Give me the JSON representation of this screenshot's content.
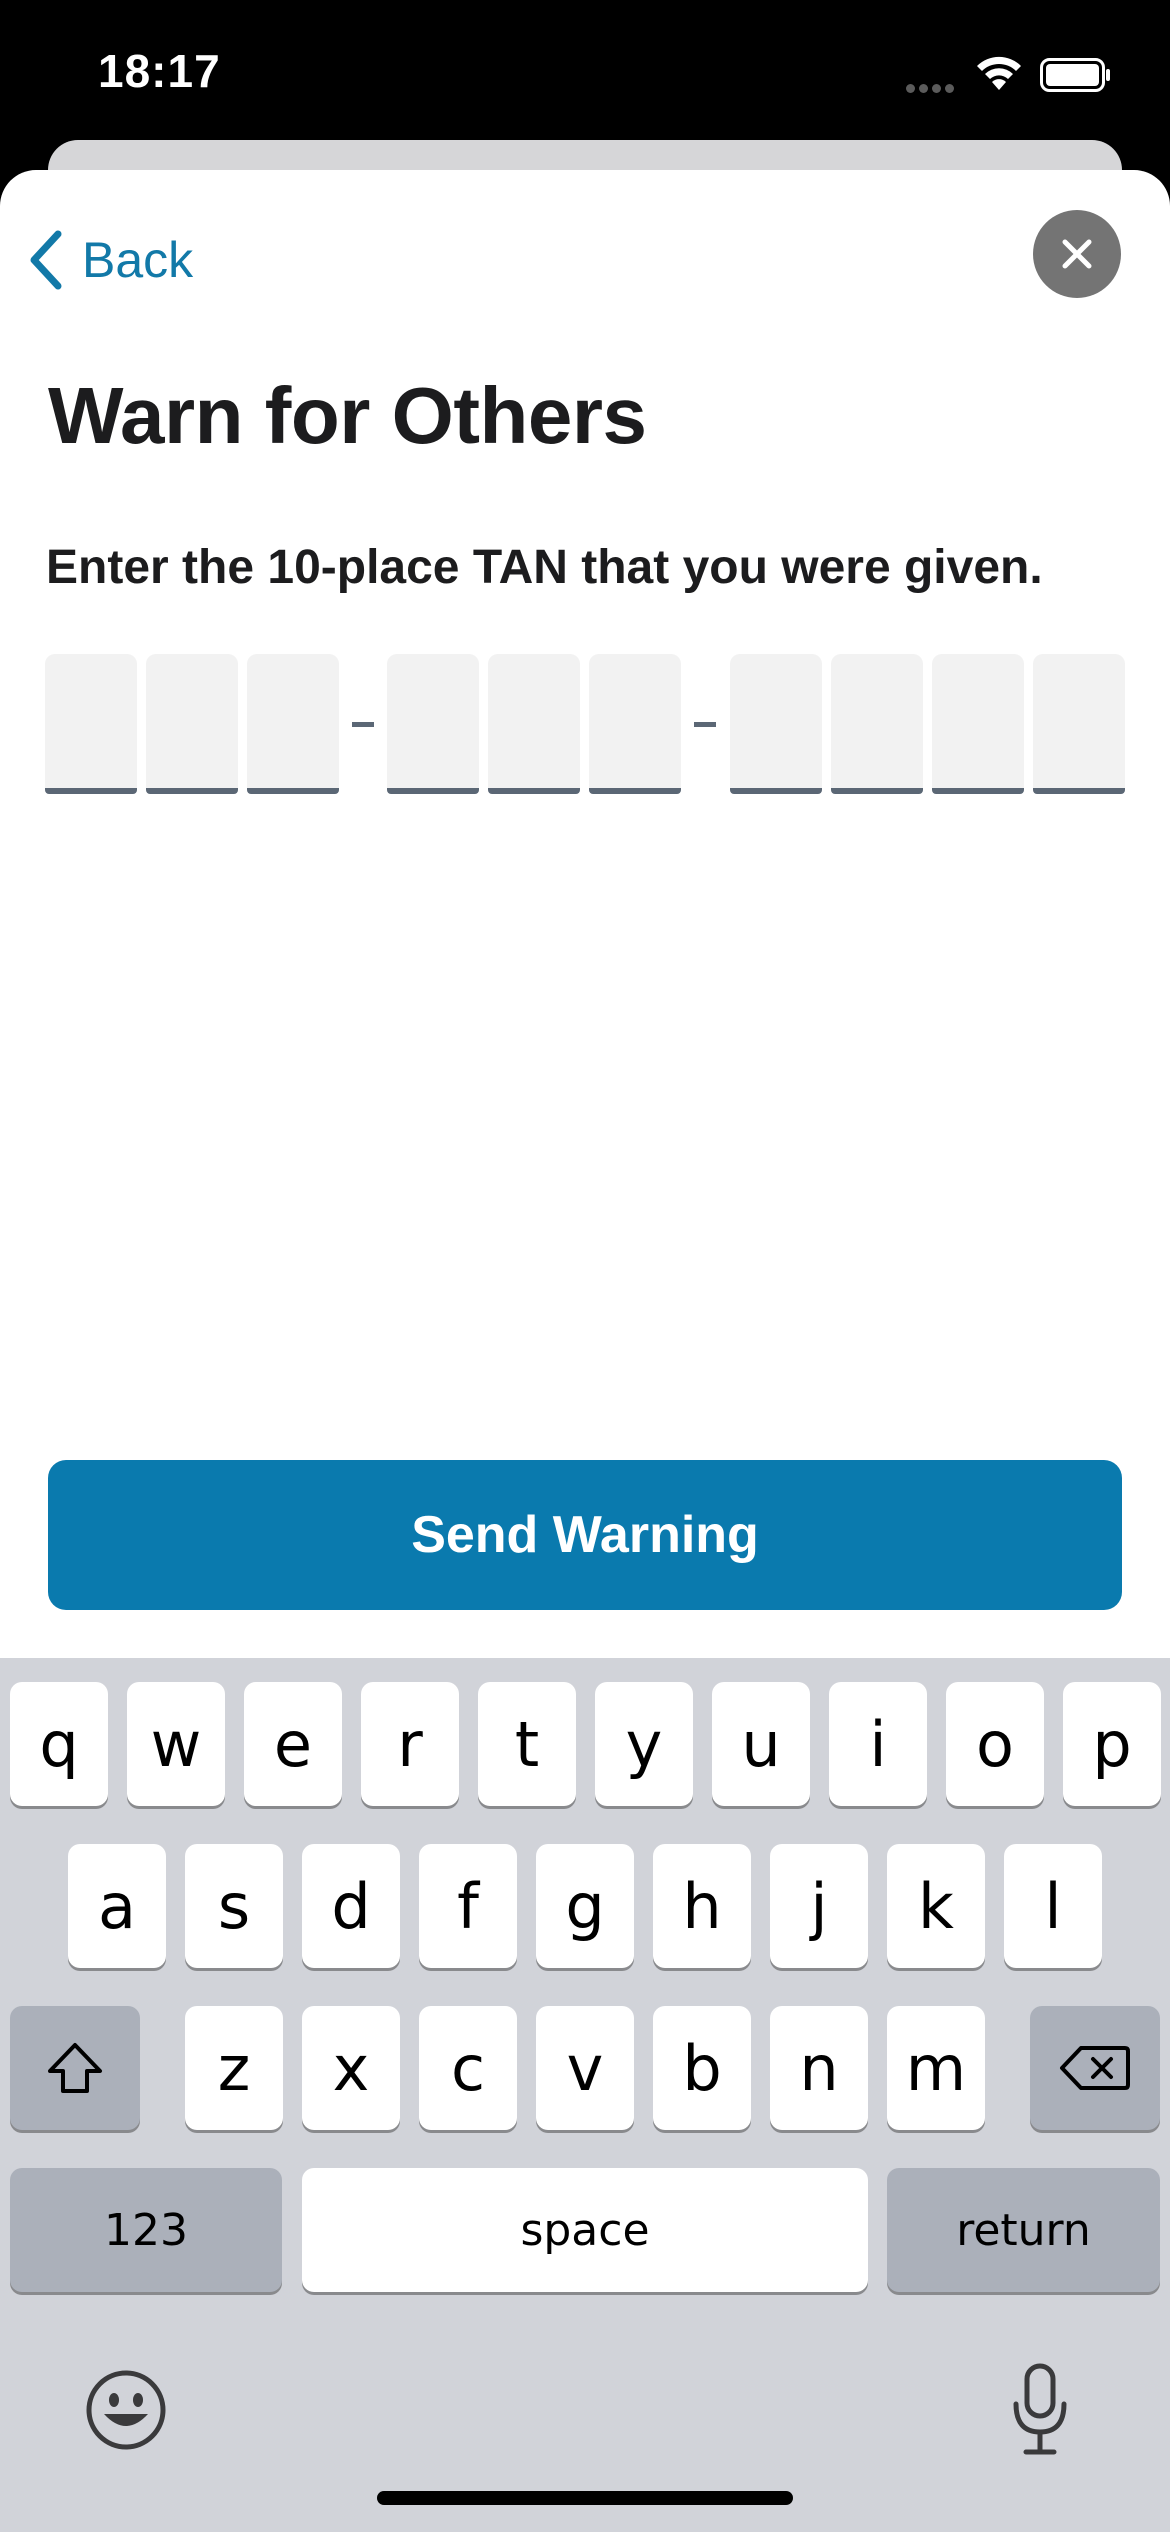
{
  "status_bar": {
    "time": "18:17"
  },
  "nav": {
    "back_label": "Back"
  },
  "page": {
    "title": "Warn for Others",
    "instruction": "Enter the 10-place TAN that you were given."
  },
  "tan": {
    "groups": [
      3,
      3,
      4
    ],
    "separator": "-",
    "values": [
      "",
      "",
      "",
      "",
      "",
      "",
      "",
      "",
      "",
      ""
    ]
  },
  "actions": {
    "send_label": "Send Warning"
  },
  "keyboard": {
    "row1": [
      "q",
      "w",
      "e",
      "r",
      "t",
      "y",
      "u",
      "i",
      "o",
      "p"
    ],
    "row2": [
      "a",
      "s",
      "d",
      "f",
      "g",
      "h",
      "j",
      "k",
      "l"
    ],
    "row3": [
      "z",
      "x",
      "c",
      "v",
      "b",
      "n",
      "m"
    ],
    "numbers_label": "123",
    "space_label": "space",
    "return_label": "return",
    "shift_icon": "shift-icon",
    "delete_icon": "delete-icon",
    "emoji_icon": "emoji-icon",
    "mic_icon": "microphone-icon"
  },
  "colors": {
    "accent": "#0a7aae",
    "link": "#1279a8",
    "tan_underline": "#5b6775"
  }
}
